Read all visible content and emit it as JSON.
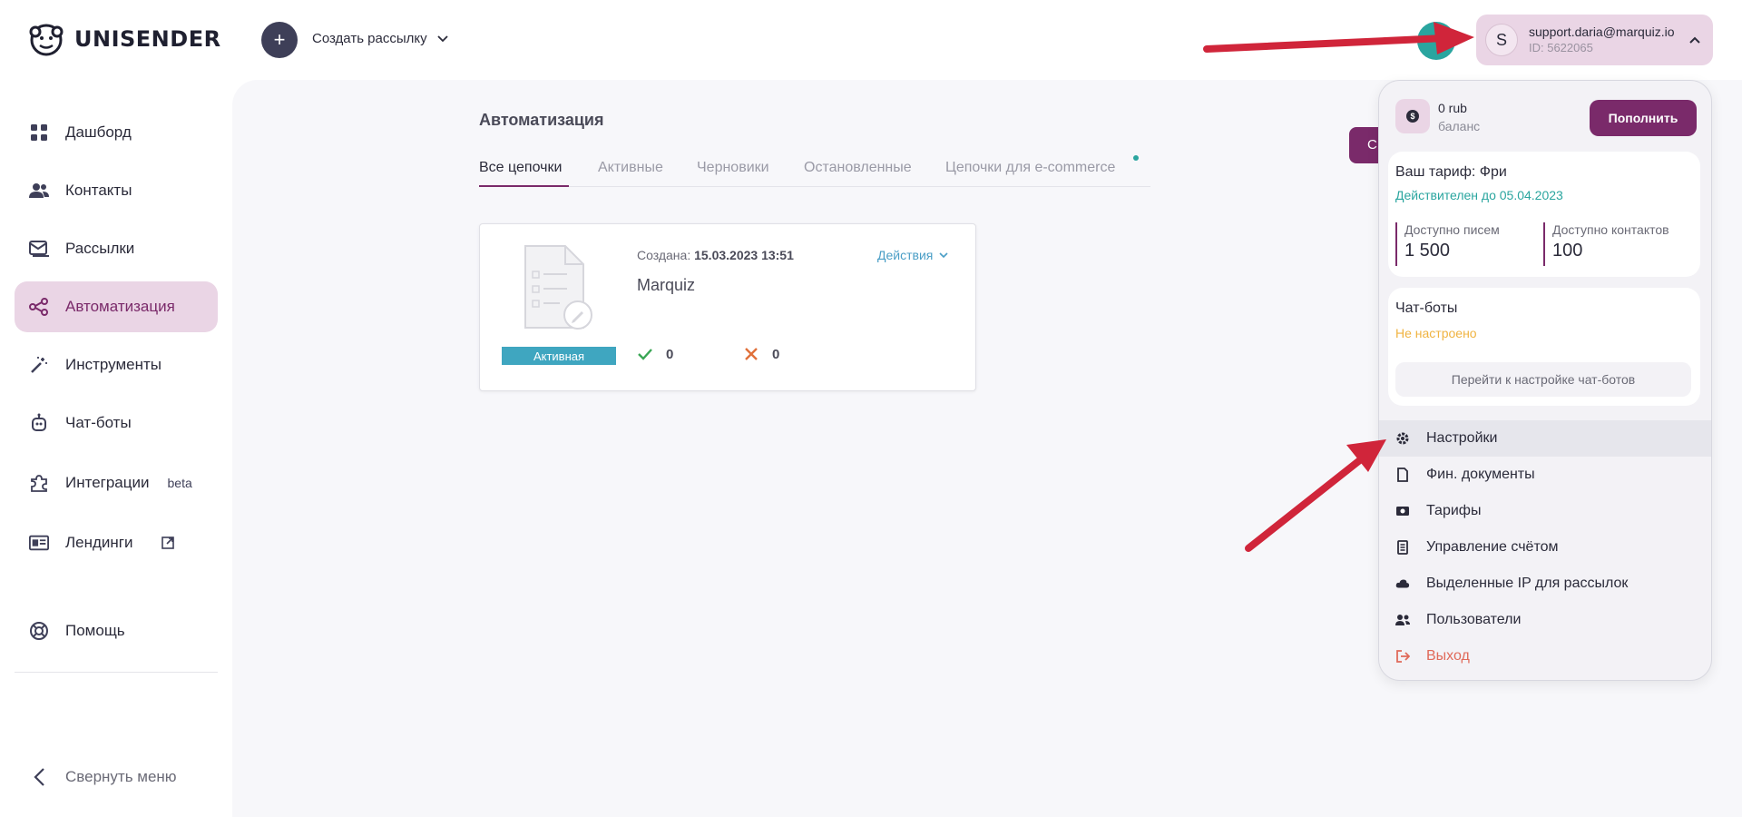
{
  "brand": {
    "name": "UNISENDER"
  },
  "header": {
    "create_label": "Создать рассылку",
    "create_icon": "plus-icon",
    "user": {
      "avatar_letter": "S",
      "email": "support.daria@marquiz.io",
      "id": "ID: 5622065"
    }
  },
  "sidebar": {
    "items": [
      {
        "label": "Дашборд",
        "icon": "dashboard-grid-icon"
      },
      {
        "label": "Контакты",
        "icon": "users-icon"
      },
      {
        "label": "Рассылки",
        "icon": "mail-icon"
      },
      {
        "label": "Автоматизация",
        "icon": "automation-share-icon"
      },
      {
        "label": "Инструменты",
        "icon": "magic-wand-icon"
      },
      {
        "label": "Чат-боты",
        "icon": "robot-icon"
      },
      {
        "label": "Интеграции",
        "icon": "puzzle-icon",
        "badge": "beta"
      },
      {
        "label": "Лендинги",
        "icon": "landing-layout-icon"
      },
      {
        "label": "Помощь",
        "icon": "lifebuoy-icon"
      }
    ],
    "collapse_label": "Свернуть меню"
  },
  "main": {
    "title": "Автоматизация",
    "tabs": [
      "Все цепочки",
      "Активные",
      "Черновики",
      "Остановленные",
      "Цепочки для e-commerce"
    ],
    "cta_label": "С",
    "card": {
      "created_label": "Создана:",
      "created_value": "15.03.2023 13:51",
      "name": "Marquiz",
      "actions_label": "Действия",
      "status": "Активная",
      "success_count": "0",
      "fail_count": "0"
    }
  },
  "dropdown": {
    "balance_amount": "0 rub",
    "balance_label": "баланс",
    "topup_label": "Пополнить",
    "plan_title": "Ваш тариф: Фри",
    "plan_valid": "Действителен до 05.04.2023",
    "letters_label": "Доступно писем",
    "letters_value": "1 500",
    "contacts_label": "Доступно контактов",
    "contacts_value": "100",
    "bots_title": "Чат-боты",
    "bots_status": "Не настроено",
    "bots_button": "Перейти к настройке чат-ботов",
    "menu": [
      {
        "label": "Настройки",
        "icon": "gear-icon"
      },
      {
        "label": "Фин. документы",
        "icon": "document-icon"
      },
      {
        "label": "Тарифы",
        "icon": "banknote-icon"
      },
      {
        "label": "Управление счётом",
        "icon": "ledger-icon"
      },
      {
        "label": "Выделенные IP для рассылок",
        "icon": "cloud-icon"
      },
      {
        "label": "Пользователи",
        "icon": "users-icon"
      },
      {
        "label": "Выход",
        "icon": "logout-icon"
      }
    ]
  },
  "colors": {
    "brand_purple": "#7a2a6a",
    "active_bg": "#ead5e5",
    "teal": "#2aa59f",
    "badge_blue": "#3fa6c0",
    "warning": "#f0b340",
    "logout_red": "#e06a5a",
    "arrow_red": "#d0253a"
  }
}
